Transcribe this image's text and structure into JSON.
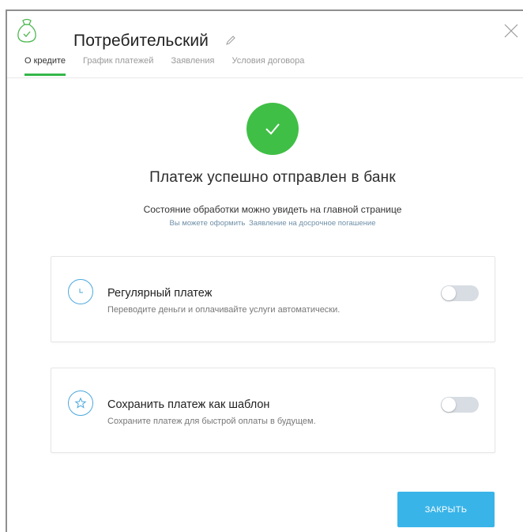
{
  "header": {
    "title": "Потребительский"
  },
  "tabs": [
    {
      "label": "О кредите",
      "active": true
    },
    {
      "label": "График платежей",
      "active": false
    },
    {
      "label": "Заявления",
      "active": false
    },
    {
      "label": "Условия договора",
      "active": false
    }
  ],
  "status": {
    "heading": "Платеж успешно отправлен в банк",
    "subtitle": "Состояние обработки можно увидеть на главной странице",
    "hint_prefix": "Вы можете оформить",
    "hint_link": "Заявление на досрочное погашение"
  },
  "cards": [
    {
      "title": "Регулярный платеж",
      "description": "Переводите деньги и оплачивайте услуги автоматически.",
      "icon": "clock-icon",
      "enabled": false
    },
    {
      "title": "Сохранить платеж как шаблон",
      "description": "Сохраните платеж для быстрой оплаты в будущем.",
      "icon": "star-icon",
      "enabled": false
    }
  ],
  "footer": {
    "close_label": "ЗАКРЫТЬ"
  },
  "colors": {
    "accent_green": "#40bf46",
    "accent_blue": "#39b4e8",
    "link_blue": "#4aa8de"
  }
}
